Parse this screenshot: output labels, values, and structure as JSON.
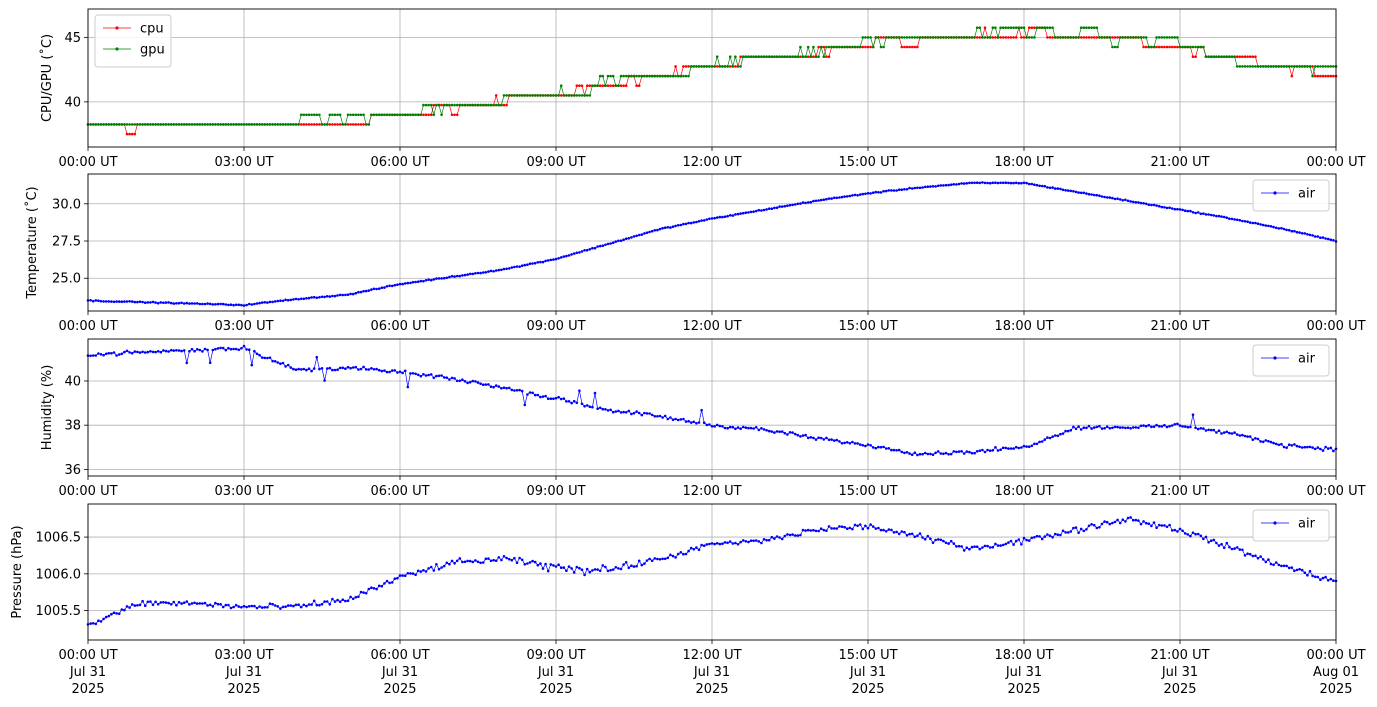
{
  "x_tick_labels": [
    "00:00 UT",
    "03:00 UT",
    "06:00 UT",
    "09:00 UT",
    "12:00 UT",
    "15:00 UT",
    "18:00 UT",
    "21:00 UT",
    "00:00 UT"
  ],
  "x_tick_dates": [
    [
      "Jul 31",
      "2025"
    ],
    [
      "Jul 31",
      "2025"
    ],
    [
      "Jul 31",
      "2025"
    ],
    [
      "Jul 31",
      "2025"
    ],
    [
      "Jul 31",
      "2025"
    ],
    [
      "Jul 31",
      "2025"
    ],
    [
      "Jul 31",
      "2025"
    ],
    [
      "Jul 31",
      "2025"
    ],
    [
      "Aug 01",
      "2025"
    ]
  ],
  "chart_data": [
    {
      "type": "line",
      "ylabel": "CPU/GPU (˚C)",
      "x_range": [
        "2025-07-31T00:00Z",
        "2025-08-01T00:00Z"
      ],
      "ylim": [
        36.5,
        47.2
      ],
      "yticks": [
        40,
        45
      ],
      "ytick_labels": [
        "40",
        "45"
      ],
      "grid": true,
      "legend": "upper left",
      "series": [
        {
          "name": "cpu",
          "color": "#ff0000",
          "x": [
            "00:00",
            "01:00",
            "02:00",
            "03:00",
            "04:00",
            "05:00",
            "06:00",
            "07:00",
            "08:00",
            "09:00",
            "10:00",
            "11:00",
            "12:00",
            "13:00",
            "14:00",
            "15:00",
            "16:00",
            "17:00",
            "18:00",
            "19:00",
            "20:00",
            "21:00",
            "22:00",
            "23:00",
            "24:00"
          ],
          "values": [
            38.2,
            38.2,
            38.2,
            38.2,
            38.3,
            38.6,
            39.0,
            39.5,
            40.1,
            40.7,
            41.4,
            42.1,
            42.9,
            43.4,
            43.9,
            44.5,
            44.9,
            45.2,
            45.3,
            45.2,
            44.7,
            44.1,
            43.3,
            42.6,
            42.3
          ]
        },
        {
          "name": "gpu",
          "color": "#008000",
          "x": [
            "00:00",
            "01:00",
            "02:00",
            "03:00",
            "04:00",
            "05:00",
            "06:00",
            "07:00",
            "08:00",
            "09:00",
            "10:00",
            "11:00",
            "12:00",
            "13:00",
            "14:00",
            "15:00",
            "16:00",
            "17:00",
            "18:00",
            "19:00",
            "20:00",
            "21:00",
            "22:00",
            "23:00",
            "24:00"
          ],
          "values": [
            38.3,
            38.3,
            38.3,
            38.3,
            38.4,
            38.7,
            39.1,
            39.6,
            40.2,
            40.8,
            41.5,
            42.2,
            43.0,
            43.5,
            44.0,
            44.6,
            45.0,
            45.3,
            45.4,
            45.3,
            44.8,
            44.2,
            43.4,
            42.7,
            42.4
          ]
        }
      ]
    },
    {
      "type": "line",
      "ylabel": "Temperature (˚C)",
      "x_range": [
        "2025-07-31T00:00Z",
        "2025-08-01T00:00Z"
      ],
      "ylim": [
        22.8,
        32.0
      ],
      "yticks": [
        25.0,
        27.5,
        30.0
      ],
      "ytick_labels": [
        "25.0",
        "27.5",
        "30.0"
      ],
      "grid": true,
      "legend": "upper right",
      "series": [
        {
          "name": "air",
          "color": "#0000ff",
          "x": [
            "00:00",
            "01:00",
            "02:00",
            "03:00",
            "04:00",
            "05:00",
            "06:00",
            "07:00",
            "08:00",
            "09:00",
            "10:00",
            "11:00",
            "12:00",
            "13:00",
            "14:00",
            "15:00",
            "16:00",
            "17:00",
            "18:00",
            "19:00",
            "20:00",
            "21:00",
            "22:00",
            "23:00",
            "24:00"
          ],
          "values": [
            23.5,
            23.4,
            23.3,
            23.2,
            23.6,
            23.9,
            24.6,
            25.1,
            25.6,
            26.3,
            27.3,
            28.3,
            29.0,
            29.6,
            30.2,
            30.7,
            31.1,
            31.4,
            31.4,
            30.8,
            30.2,
            29.6,
            29.0,
            28.3,
            27.5
          ]
        }
      ]
    },
    {
      "type": "line",
      "ylabel": "Humidity (%)",
      "x_range": [
        "2025-07-31T00:00Z",
        "2025-08-01T00:00Z"
      ],
      "ylim": [
        35.7,
        41.9
      ],
      "yticks": [
        36,
        38,
        40
      ],
      "ytick_labels": [
        "36",
        "38",
        "40"
      ],
      "grid": true,
      "legend": "upper right",
      "series": [
        {
          "name": "air",
          "color": "#0000ff",
          "x": [
            "00:00",
            "01:00",
            "02:00",
            "03:00",
            "04:00",
            "05:00",
            "06:00",
            "07:00",
            "08:00",
            "09:00",
            "10:00",
            "11:00",
            "12:00",
            "13:00",
            "14:00",
            "15:00",
            "16:00",
            "17:00",
            "18:00",
            "19:00",
            "20:00",
            "21:00",
            "22:00",
            "23:00",
            "24:00"
          ],
          "values": [
            41.2,
            41.3,
            41.4,
            41.5,
            40.5,
            40.6,
            40.4,
            40.1,
            39.7,
            39.2,
            38.7,
            38.4,
            38.0,
            37.8,
            37.4,
            37.1,
            36.7,
            36.8,
            37.0,
            37.9,
            37.9,
            38.0,
            37.6,
            37.1,
            36.9
          ]
        }
      ]
    },
    {
      "type": "line",
      "ylabel": "Pressure (hPa)",
      "x_range": [
        "2025-07-31T00:00Z",
        "2025-08-01T00:00Z"
      ],
      "ylim": [
        1005.1,
        1006.95
      ],
      "yticks": [
        1005.5,
        1006.0,
        1006.5
      ],
      "ytick_labels": [
        "1005.5",
        "1006.0",
        "1006.5"
      ],
      "grid": true,
      "legend": "upper right",
      "series": [
        {
          "name": "air",
          "color": "#0000ff",
          "x": [
            "00:00",
            "01:00",
            "02:00",
            "03:00",
            "04:00",
            "05:00",
            "06:00",
            "07:00",
            "08:00",
            "09:00",
            "10:00",
            "11:00",
            "12:00",
            "13:00",
            "14:00",
            "15:00",
            "16:00",
            "17:00",
            "18:00",
            "19:00",
            "20:00",
            "21:00",
            "22:00",
            "23:00",
            "24:00"
          ],
          "values": [
            1005.3,
            1005.6,
            1005.6,
            1005.55,
            1005.55,
            1005.65,
            1005.95,
            1006.15,
            1006.2,
            1006.1,
            1006.05,
            1006.2,
            1006.4,
            1006.45,
            1006.6,
            1006.65,
            1006.5,
            1006.35,
            1006.45,
            1006.6,
            1006.75,
            1006.6,
            1006.35,
            1006.1,
            1005.9
          ]
        }
      ]
    }
  ]
}
